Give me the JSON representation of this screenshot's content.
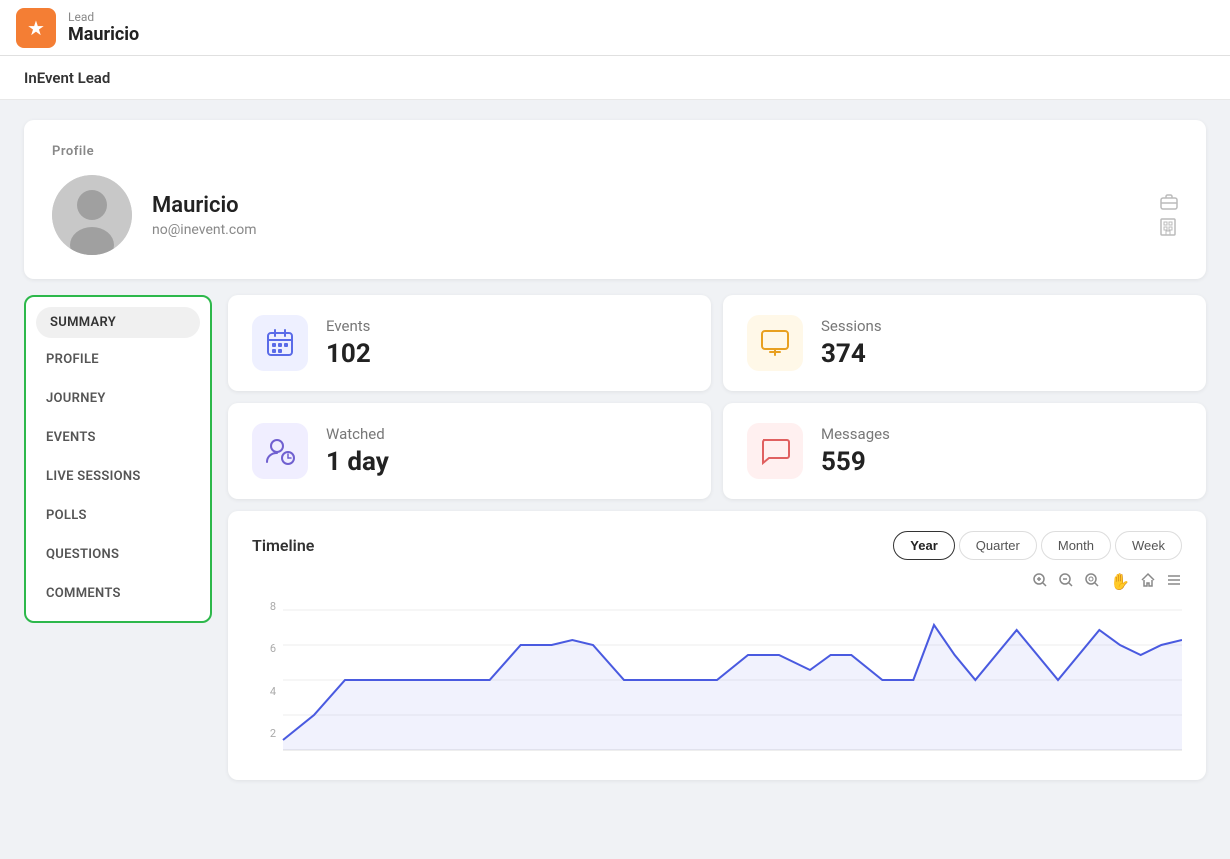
{
  "header": {
    "logo_icon": "★",
    "subtitle": "Lead",
    "title": "Mauricio"
  },
  "page_title": "InEvent Lead",
  "profile": {
    "section_label": "Profile",
    "name": "Mauricio",
    "email": "no@inevent.com",
    "icon1": "briefcase",
    "icon2": "building"
  },
  "nav": {
    "items": [
      {
        "label": "SUMMARY",
        "active": true
      },
      {
        "label": "PROFILE",
        "active": false
      },
      {
        "label": "JOURNEY",
        "active": false
      },
      {
        "label": "EVENTS",
        "active": false
      },
      {
        "label": "LIVE SESSIONS",
        "active": false
      },
      {
        "label": "POLLS",
        "active": false
      },
      {
        "label": "QUESTIONS",
        "active": false
      },
      {
        "label": "COMMENTS",
        "active": false
      }
    ]
  },
  "stats": [
    {
      "label": "Events",
      "value": "102",
      "icon_type": "blue",
      "icon": "calendar"
    },
    {
      "label": "Sessions",
      "value": "374",
      "icon_type": "yellow",
      "icon": "monitor"
    },
    {
      "label": "Watched",
      "value": "1 day",
      "icon_type": "purple",
      "icon": "person-clock"
    },
    {
      "label": "Messages",
      "value": "559",
      "icon_type": "pink",
      "icon": "message"
    }
  ],
  "timeline": {
    "title": "Timeline",
    "filters": [
      "Year",
      "Quarter",
      "Month",
      "Week"
    ],
    "active_filter": "Year",
    "y_labels": [
      "8",
      "6",
      "4",
      "2"
    ],
    "chart_controls": [
      "+",
      "-",
      "🔍",
      "✋",
      "🏠",
      "≡"
    ]
  }
}
